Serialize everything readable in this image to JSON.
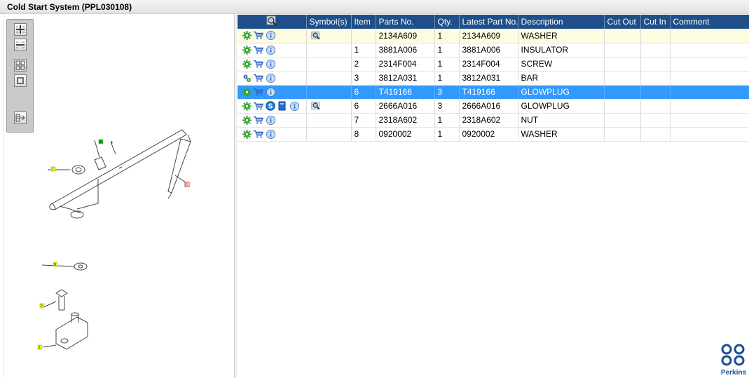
{
  "window": {
    "title": "Cold Start System (PPL030108)"
  },
  "table": {
    "headers": {
      "symbols": "Symbol(s)",
      "item": "Item",
      "parts_no": "Parts No.",
      "qty": "Qty.",
      "latest": "Latest Part No.",
      "description": "Description",
      "cut_out": "Cut Out",
      "cut_in": "Cut In",
      "comment": "Comment"
    },
    "rows": [
      {
        "item": "",
        "parts_no": "2134A609",
        "qty": "1",
        "latest": "2134A609",
        "description": "WASHER",
        "state": "highlight",
        "icons": [
          "gear-icon",
          "cart-icon",
          "info-icon"
        ],
        "symbols": [
          "magnify-icon"
        ]
      },
      {
        "item": "1",
        "parts_no": "3881A006",
        "qty": "1",
        "latest": "3881A006",
        "description": "INSULATOR",
        "state": "normal",
        "icons": [
          "gear-icon",
          "cart-icon",
          "info-icon"
        ],
        "symbols": []
      },
      {
        "item": "2",
        "parts_no": "2314F004",
        "qty": "1",
        "latest": "2314F004",
        "description": "SCREW",
        "state": "normal",
        "icons": [
          "gear-icon",
          "cart-icon",
          "info-icon"
        ],
        "symbols": []
      },
      {
        "item": "3",
        "parts_no": "3812A031",
        "qty": "1",
        "latest": "3812A031",
        "description": "BAR",
        "state": "normal",
        "icons": [
          "gears-icon",
          "cart-icon",
          "info-icon"
        ],
        "symbols": []
      },
      {
        "item": "6",
        "parts_no": "T419166",
        "qty": "3",
        "latest": "T419166",
        "description": "GLOWPLUG",
        "state": "selected",
        "icons": [
          "gear-icon",
          "cart-icon",
          "info-icon"
        ],
        "symbols": []
      },
      {
        "item": "6",
        "parts_no": "2666A016",
        "qty": "3",
        "latest": "2666A016",
        "description": "GLOWPLUG",
        "state": "normal",
        "icons": [
          "gear-icon",
          "cart-icon",
          "service-icon",
          "book-icon",
          "info-icon"
        ],
        "symbols": [
          "magnify-icon"
        ]
      },
      {
        "item": "7",
        "parts_no": "2318A602",
        "qty": "1",
        "latest": "2318A602",
        "description": "NUT",
        "state": "normal",
        "icons": [
          "gear-icon",
          "cart-icon",
          "info-icon"
        ],
        "symbols": []
      },
      {
        "item": "8",
        "parts_no": "0920002",
        "qty": "1",
        "latest": "0920002",
        "description": "WASHER",
        "state": "normal",
        "icons": [
          "gear-icon",
          "cart-icon",
          "info-icon"
        ],
        "symbols": []
      }
    ]
  },
  "drawing": {
    "callouts": [
      "5",
      "4",
      "7",
      "6",
      "8",
      "2",
      "1"
    ]
  },
  "brand": {
    "name": "Perkins",
    "color": "#1b4f94"
  },
  "colors": {
    "header": "#1e4f8a",
    "selected": "#3399ff",
    "highlight": "#fdfbe0"
  }
}
